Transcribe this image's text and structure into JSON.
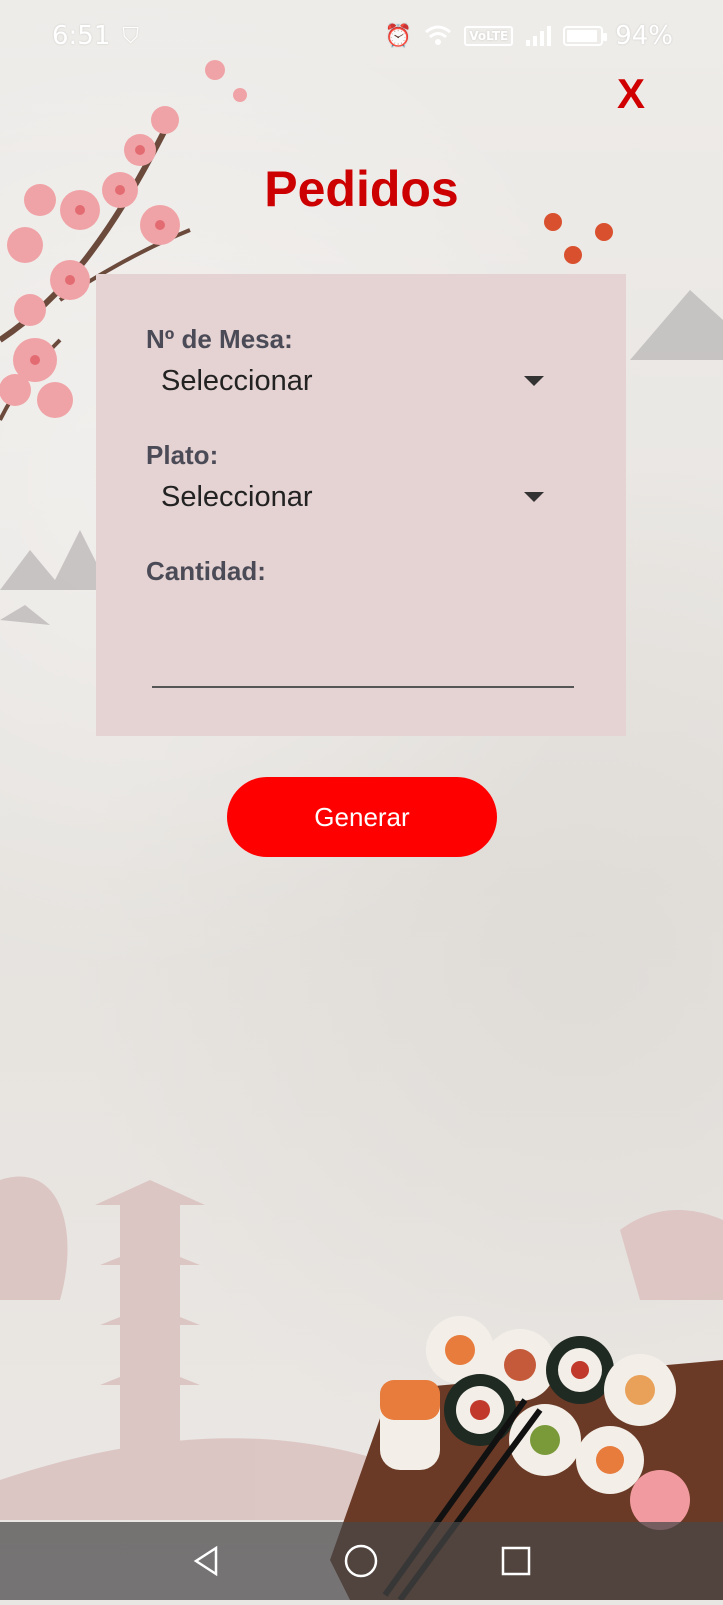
{
  "status_bar": {
    "time": "6:51",
    "volte_label": "VoLTE",
    "battery_percent": "94%",
    "battery_level": 0.94,
    "icons": [
      "vpn-shield-icon",
      "alarm-icon",
      "wifi-icon",
      "signal-icon",
      "battery-icon"
    ]
  },
  "header": {
    "close_label": "X",
    "title": "Pedidos"
  },
  "form": {
    "table_label": "Nº de Mesa:",
    "table_value": "Seleccionar",
    "dish_label": "Plato:",
    "dish_value": "Seleccionar",
    "quantity_label": "Cantidad:",
    "quantity_value": ""
  },
  "actions": {
    "generate_label": "Generar"
  },
  "nav_bar": {
    "icons": [
      "back-icon",
      "home-icon",
      "recents-icon"
    ]
  },
  "colors": {
    "accent": "#cc0000",
    "button": "#ff0000",
    "panel": "#e5d2d2",
    "label": "#4b4b57"
  }
}
